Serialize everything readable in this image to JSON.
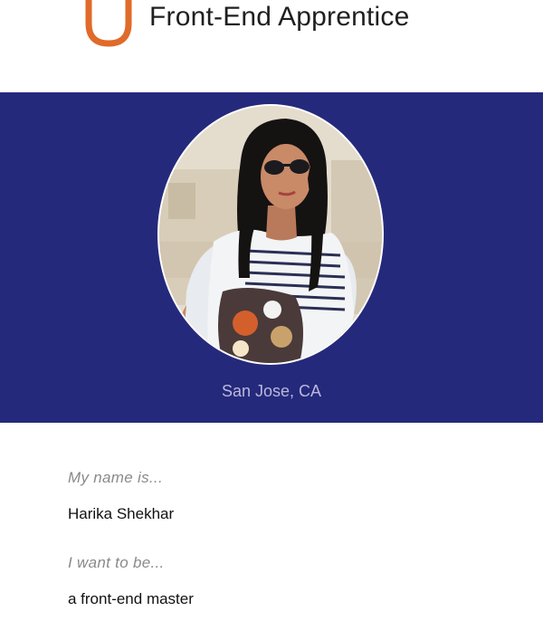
{
  "header": {
    "title": "Front-End Apprentice",
    "logo_icon": "udacity-u-logo-icon",
    "logo_color": "#e06a2a"
  },
  "hero": {
    "background_color": "#25297b",
    "photo_icon": "profile-photo",
    "location": "San Jose, CA"
  },
  "bio": {
    "name_label": "My name is...",
    "name_value": "Harika Shekhar",
    "goal_label": "I want to be...",
    "goal_value": "a front-end master"
  }
}
